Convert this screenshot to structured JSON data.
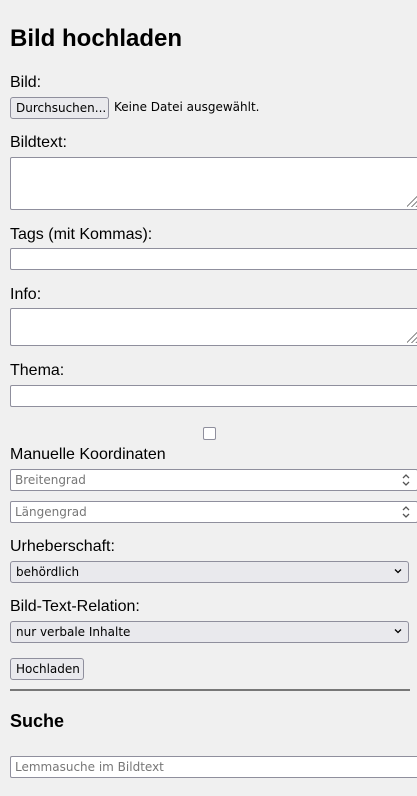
{
  "page": {
    "title": "Bild hochladen"
  },
  "form": {
    "image_label": "Bild:",
    "browse_label": "Durchsuchen...",
    "file_status": "Keine Datei ausgewählt.",
    "caption_label": "Bildtext:",
    "tags_label": "Tags (mit Kommas):",
    "info_label": "Info:",
    "topic_label": "Thema:",
    "manual_coords_label": "Manuelle Koordinaten",
    "latitude_placeholder": "Breitengrad",
    "longitude_placeholder": "Längengrad",
    "authorship_label": "Urheberschaft:",
    "authorship_value": "behördlich",
    "relation_label": "Bild-Text-Relation:",
    "relation_value": "nur verbale Inhalte",
    "upload_label": "Hochladen",
    "manual_coords_checked": false
  },
  "search": {
    "title": "Suche",
    "placeholder": "Lemmasuche im Bildtext"
  }
}
